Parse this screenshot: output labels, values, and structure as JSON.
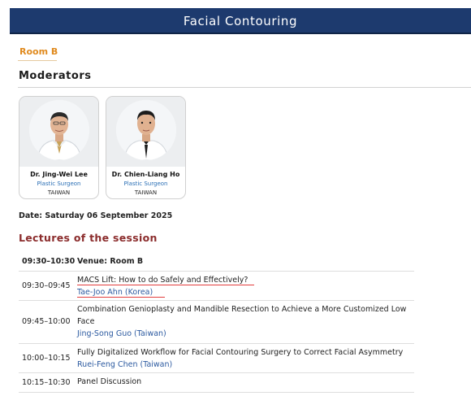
{
  "header": {
    "title": "Facial Contouring"
  },
  "room_tab": {
    "label": "Room B"
  },
  "moderators": {
    "heading": "Moderators",
    "people": [
      {
        "name": "Dr. Jing-Wei Lee",
        "title": "Plastic Surgeon",
        "country": "TAIWAN"
      },
      {
        "name": "Dr. Chien-Liang Ho",
        "title": "Plastic Surgeon",
        "country": "TAIWAN"
      }
    ]
  },
  "date": "Date: Saturday 06 September 2025",
  "lectures": {
    "heading": "Lectures of the session",
    "header_row": {
      "time": "09:30–10:30",
      "venue": "Venue: Room B"
    },
    "items": [
      {
        "time": "09:30–09:45",
        "topic": "MACS Lift: How to do Safely and Effectively?",
        "speaker": "Tae-Joo Ahn (Korea)"
      },
      {
        "time": "09:45–10:00",
        "topic_line1": "Combination Genioplasty and Mandible Resection to Achieve a More Customized Low",
        "topic_line2": "Face",
        "speaker": "Jing-Song Guo (Taiwan)"
      },
      {
        "time": "10:00–10:15",
        "topic": "Fully Digitalized Workflow for Facial Contouring Surgery to Correct Facial Asymmetry",
        "speaker": "Ruei-Feng Chen (Taiwan)"
      },
      {
        "time": "10:15–10:30",
        "topic": "Panel Discussion"
      }
    ]
  },
  "colors": {
    "banner": "#1d3a6e",
    "room_tab": "#e08a1e",
    "lectures_heading": "#8b2c2c",
    "speaker": "#2c5aa0",
    "highlight": "#e23d3d"
  }
}
